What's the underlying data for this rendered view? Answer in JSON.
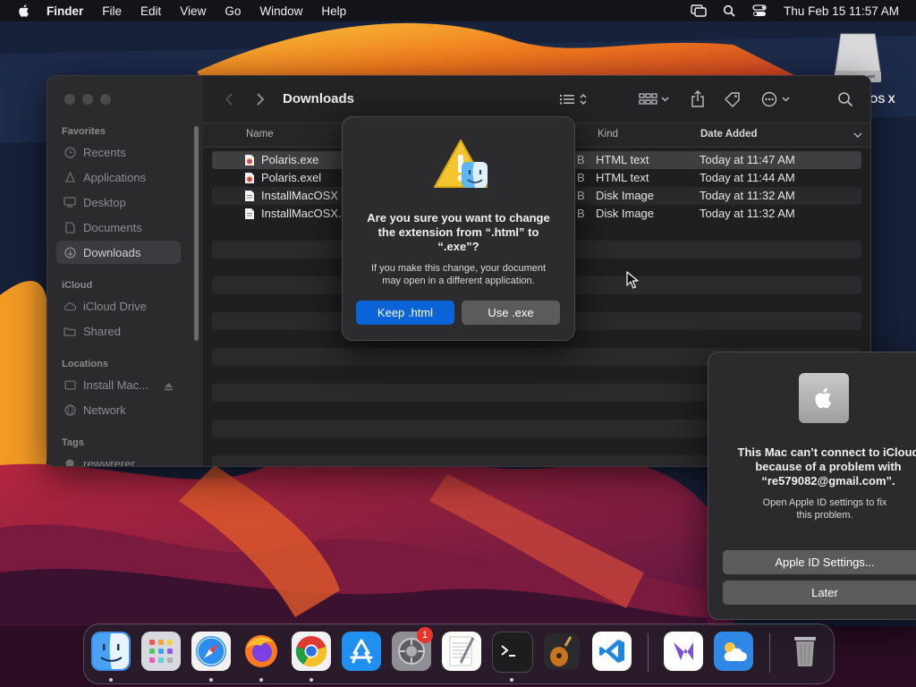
{
  "menubar": {
    "app_name": "Finder",
    "menus": [
      "File",
      "Edit",
      "View",
      "Go",
      "Window",
      "Help"
    ],
    "clock": "Thu Feb 15  11:57 AM",
    "icons": [
      "apple-icon",
      "screen-mirroring-icon",
      "search-icon",
      "control-center-icon"
    ]
  },
  "desktop": {
    "disk_label": "OS X"
  },
  "finder": {
    "title": "Downloads",
    "sidebar": {
      "sections": [
        {
          "label": "Favorites",
          "items": [
            "Recents",
            "Applications",
            "Desktop",
            "Documents",
            "Downloads"
          ]
        },
        {
          "label": "iCloud",
          "items": [
            "iCloud Drive",
            "Shared"
          ]
        },
        {
          "label": "Locations",
          "items": [
            "Install Mac...",
            "Network"
          ]
        },
        {
          "label": "Tags",
          "items": [
            "rewwrerer"
          ]
        }
      ],
      "selected": "Downloads"
    },
    "columns": {
      "name": "Name",
      "kind": "Kind",
      "date_added": "Date Added"
    },
    "files": [
      {
        "name": "Polaris.exe",
        "size_tail": "B",
        "kind": "HTML text",
        "date_added": "Today at 11:47 AM",
        "selected": true
      },
      {
        "name": "Polaris.exel",
        "size_tail": "B",
        "kind": "HTML text",
        "date_added": "Today at 11:44 AM"
      },
      {
        "name": "InstallMacOSX (1)",
        "size_tail": "B",
        "kind": "Disk Image",
        "date_added": "Today at 11:32 AM"
      },
      {
        "name": "InstallMacOSX.dm",
        "size_tail": "B",
        "kind": "Disk Image",
        "date_added": "Today at 11:32 AM"
      }
    ]
  },
  "rename_alert": {
    "message_line1": "Are you sure you want to change",
    "message_line2": "the extension from “.html” to",
    "message_line3": "“.exe”?",
    "info_line1": "If you make this change, your document",
    "info_line2": "may open in a different application.",
    "keep_button": "Keep .html",
    "use_button": "Use .exe"
  },
  "icloud_alert": {
    "message_line1": "This Mac can’t connect to iCloud",
    "message_line2": "because of a problem with",
    "message_line3": "“re579082@gmail.com”.",
    "info_line1": "Open Apple ID settings to fix",
    "info_line2": "this problem.",
    "settings_button": "Apple ID Settings...",
    "later_button": "Later"
  },
  "dock": {
    "apps": [
      "finder-icon",
      "launchpad-icon",
      "safari-icon",
      "firefox-icon",
      "chrome-icon",
      "app-store-icon",
      "system-settings-icon",
      "textedit-icon",
      "terminal-icon",
      "garageband-icon",
      "vscode-icon",
      "visual-studio-icon",
      "weather-icon",
      "trash-icon"
    ],
    "settings_badge": "1"
  }
}
